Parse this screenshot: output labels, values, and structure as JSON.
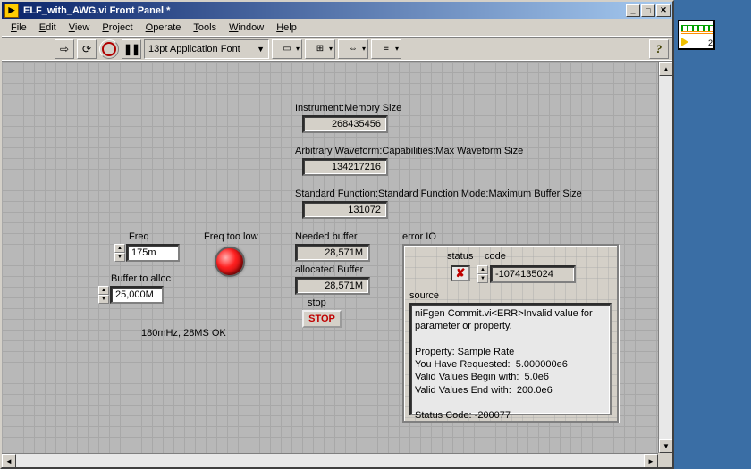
{
  "window": {
    "title": "ELF_with_AWG.vi Front Panel *",
    "icon_glyph": "▶"
  },
  "menu": {
    "items": [
      "File",
      "Edit",
      "View",
      "Project",
      "Operate",
      "Tools",
      "Window",
      "Help"
    ]
  },
  "toolbar": {
    "font": "13pt Application Font",
    "run_glyph": "⇨",
    "run_cont_glyph": "⟳",
    "pause_glyph": "❚❚",
    "help_glyph": "?"
  },
  "panel": {
    "mem_label": "Instrument:Memory Size",
    "mem_value": "268435456",
    "maxwf_label": "Arbitrary Waveform:Capabilities:Max Waveform Size",
    "maxwf_value": "134217216",
    "maxbuf_label": "Standard Function:Standard Function Mode:Maximum Buffer Size",
    "maxbuf_value": "131072",
    "freq_label": "Freq",
    "freq_value": "175m",
    "buffer_label": "Buffer to alloc",
    "buffer_value": "25,000M",
    "freq_too_low_label": "Freq too low",
    "needed_label": "Needed buffer",
    "needed_value": "28,571M",
    "alloc_label": "allocated Buffer",
    "alloc_value": "28,571M",
    "stop_label": "stop",
    "stop_btn": "STOP",
    "note": "180mHz, 28MS OK"
  },
  "error": {
    "cluster_label": "error IO",
    "status_label": "status",
    "status_glyph": "✘",
    "code_label": "code",
    "code_value": "-1074135024",
    "source_label": "source",
    "source_text": "niFgen Commit.vi<ERR>Invalid value for parameter or property.\n\nProperty: Sample Rate\nYou Have Requested:  5.000000e6\nValid Values Begin with:  5.0e6\nValid Values End with:  200.0e6\n\nStatus Code: -200077"
  },
  "side": {
    "num": "2"
  }
}
